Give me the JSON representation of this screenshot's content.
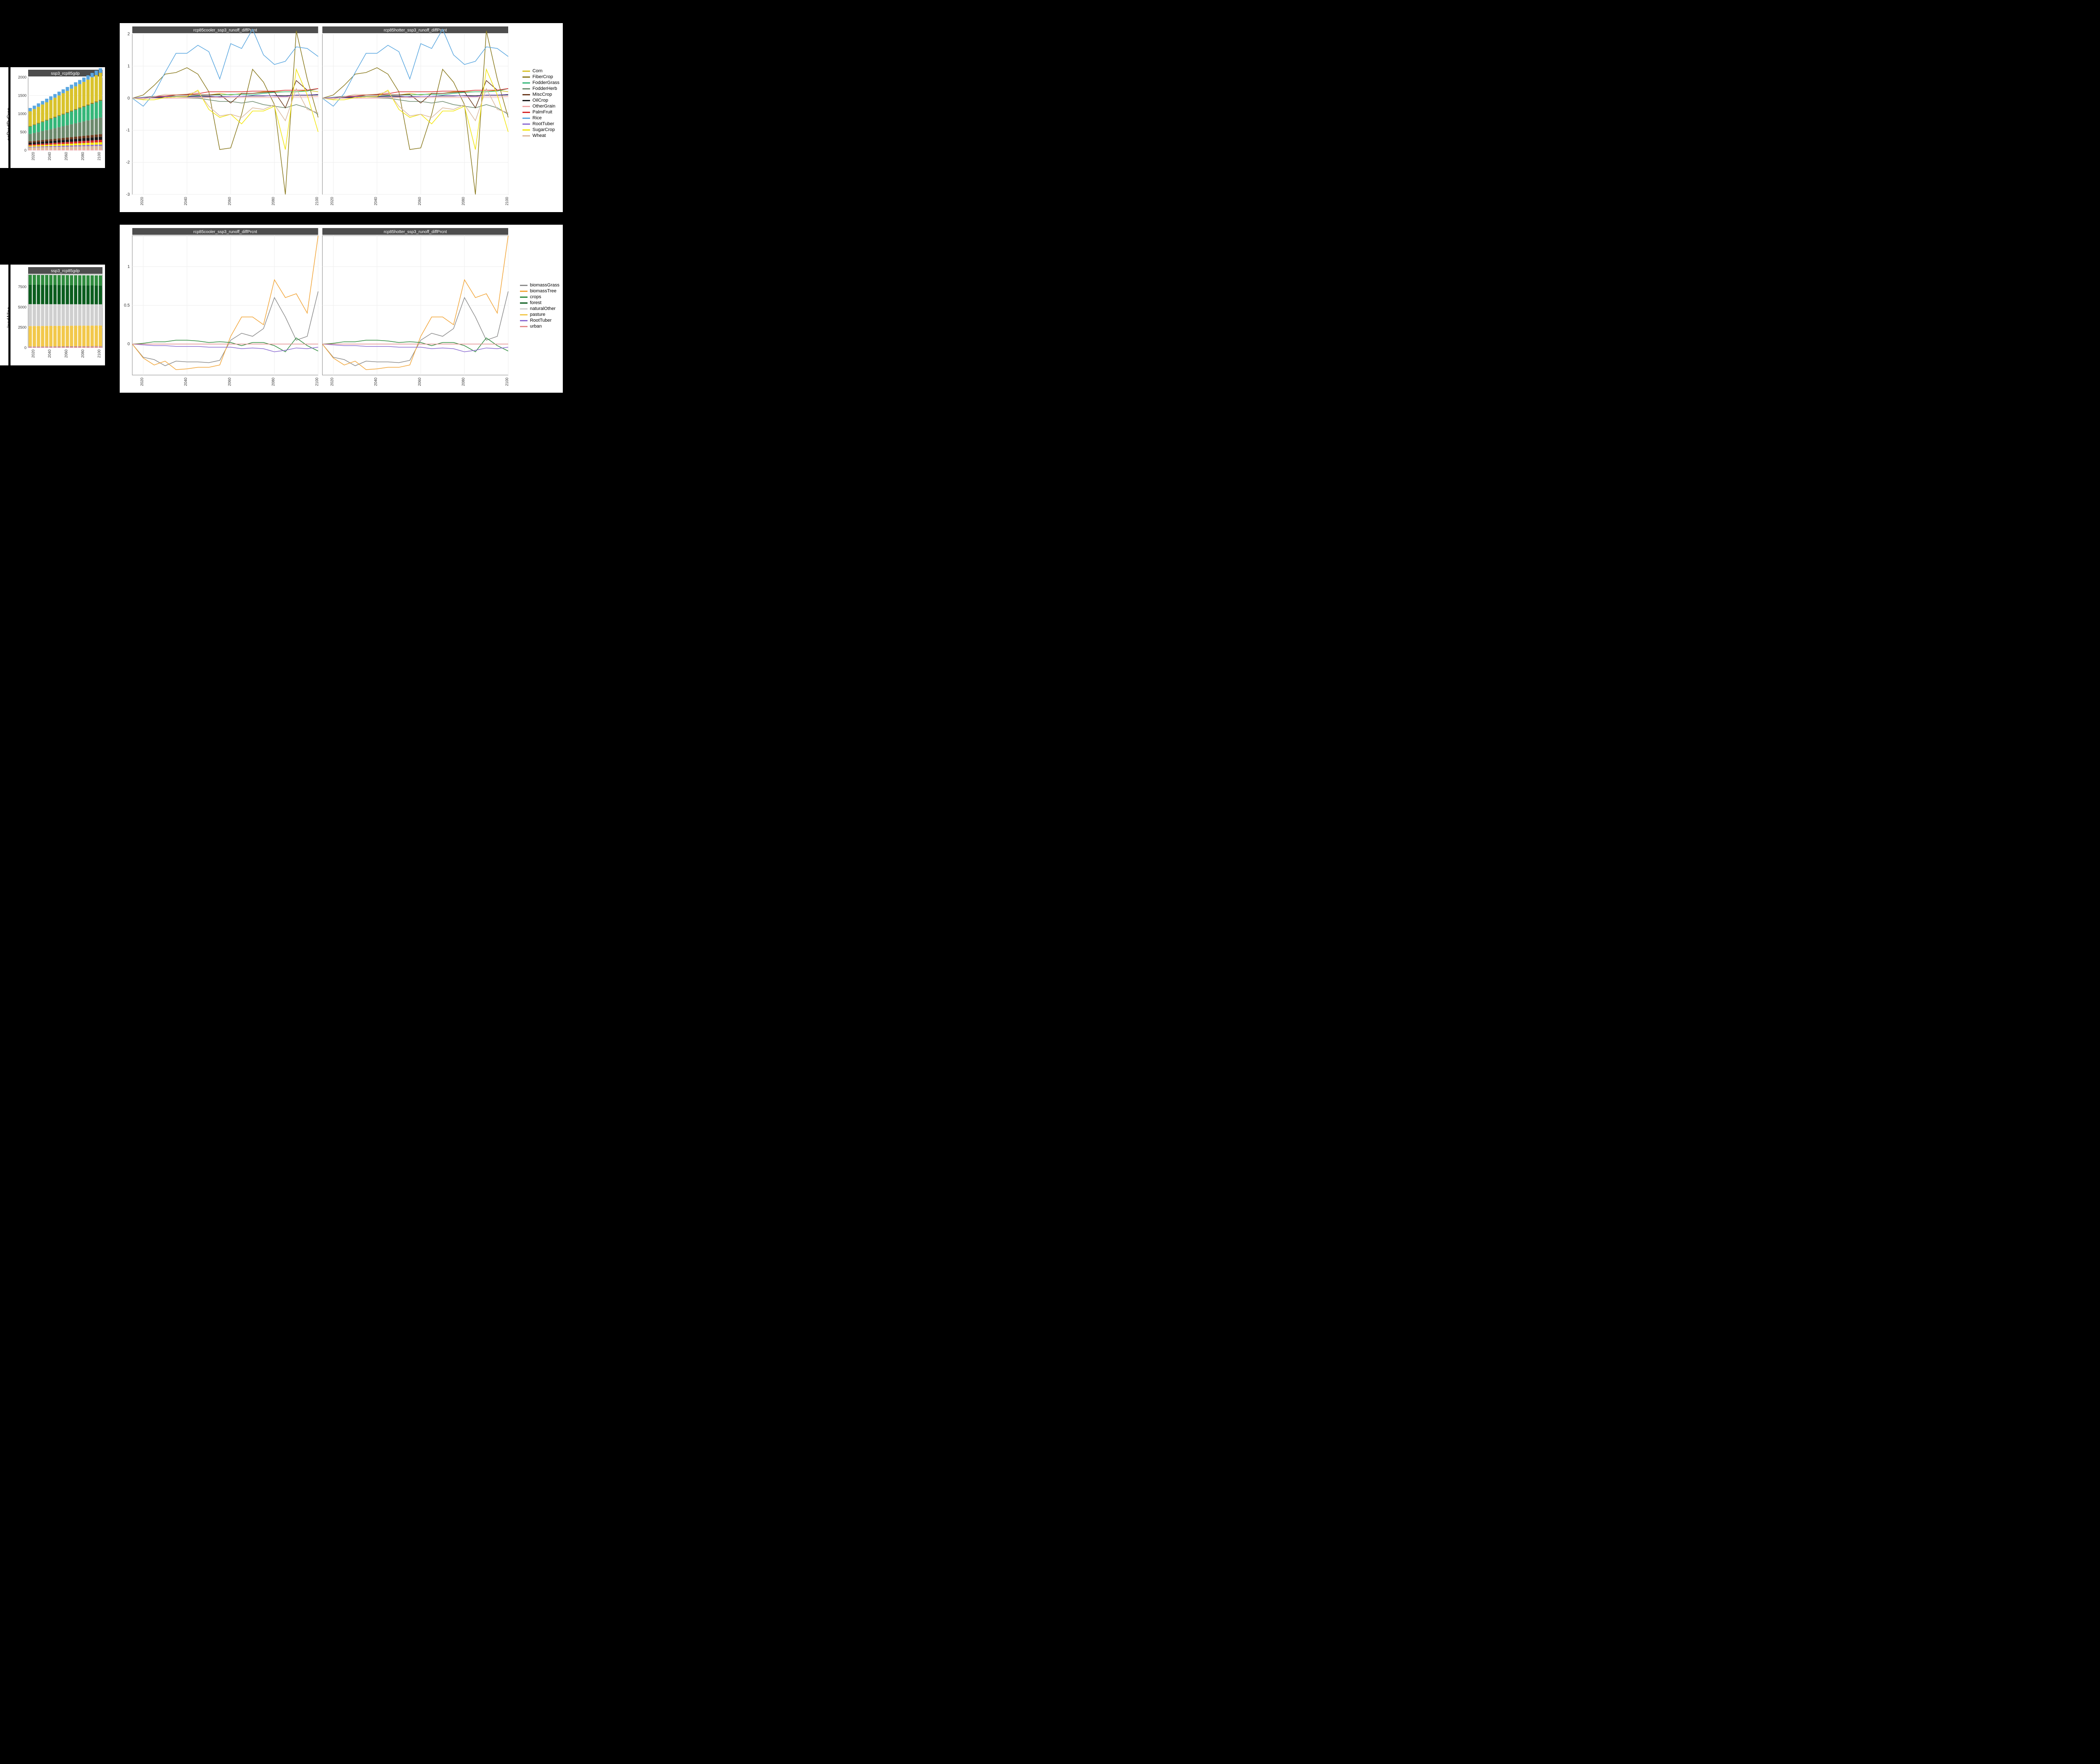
{
  "chart_data": [
    {
      "id": "agprod_bar",
      "type": "bar",
      "title": "ssp3_rcp85gdp",
      "ylabel": "agProdByCrop",
      "x": [
        2015,
        2020,
        2025,
        2030,
        2035,
        2040,
        2045,
        2050,
        2055,
        2060,
        2065,
        2070,
        2075,
        2080,
        2085,
        2090,
        2095,
        2100
      ],
      "ylim": [
        0,
        2000
      ],
      "yticks": [
        0,
        500,
        1000,
        1500,
        2000
      ],
      "stack_order": [
        "OtherGrain",
        "Wheat",
        "RootTuber",
        "SugarCrop",
        "PalmFruit",
        "OilCrop",
        "MiscCrop",
        "FodderHerb",
        "FodderGrass",
        "FiberCrop",
        "Corn",
        "Rice"
      ],
      "series": {
        "Rice": [
          90,
          92,
          94,
          96,
          98,
          100,
          102,
          104,
          106,
          108,
          110,
          112,
          114,
          116,
          118,
          120,
          122,
          124
        ],
        "Corn": [
          400,
          420,
          440,
          460,
          480,
          500,
          520,
          540,
          560,
          580,
          600,
          620,
          640,
          660,
          680,
          700,
          720,
          740
        ],
        "FiberCrop": [
          20,
          20,
          20,
          21,
          21,
          22,
          22,
          23,
          23,
          24,
          24,
          25,
          25,
          26,
          26,
          27,
          27,
          28
        ],
        "FodderGrass": [
          200,
          215,
          230,
          245,
          260,
          275,
          290,
          305,
          320,
          335,
          350,
          365,
          380,
          395,
          410,
          425,
          440,
          455
        ],
        "FodderHerb": [
          200,
          215,
          230,
          245,
          260,
          275,
          290,
          305,
          320,
          335,
          350,
          365,
          380,
          395,
          410,
          425,
          440,
          455
        ],
        "MiscCrop": [
          40,
          42,
          44,
          46,
          48,
          50,
          52,
          54,
          56,
          58,
          60,
          62,
          64,
          66,
          68,
          70,
          72,
          74
        ],
        "OilCrop": [
          50,
          52,
          54,
          56,
          58,
          60,
          62,
          64,
          66,
          68,
          70,
          72,
          74,
          76,
          78,
          80,
          82,
          84
        ],
        "PalmFruit": [
          30,
          32,
          34,
          36,
          38,
          40,
          42,
          44,
          46,
          48,
          50,
          52,
          54,
          56,
          58,
          60,
          62,
          64
        ],
        "SugarCrop": [
          30,
          32,
          34,
          36,
          38,
          40,
          42,
          44,
          46,
          48,
          50,
          52,
          54,
          56,
          58,
          60,
          62,
          64
        ],
        "RootTuber": [
          20,
          21,
          22,
          23,
          24,
          25,
          26,
          27,
          28,
          29,
          30,
          31,
          32,
          33,
          34,
          35,
          36,
          37
        ],
        "Wheat": [
          60,
          62,
          64,
          66,
          68,
          70,
          72,
          74,
          76,
          78,
          80,
          82,
          84,
          86,
          88,
          90,
          92,
          94
        ],
        "OtherGrain": [
          20,
          20,
          20,
          21,
          21,
          22,
          22,
          23,
          23,
          24,
          24,
          25,
          25,
          26,
          26,
          27,
          27,
          28
        ]
      }
    },
    {
      "id": "landalloc_bar",
      "type": "bar",
      "title": "ssp3_rcp85gdp",
      "ylabel": "landAlloc",
      "x": [
        2015,
        2020,
        2025,
        2030,
        2035,
        2040,
        2045,
        2050,
        2055,
        2060,
        2065,
        2070,
        2075,
        2080,
        2085,
        2090,
        2095,
        2100
      ],
      "ylim": [
        0,
        9000
      ],
      "yticks": [
        0,
        2500,
        5000,
        7500
      ],
      "stack_order": [
        "urban",
        "RootTuber",
        "biomassGrass",
        "biomassTree",
        "pasture",
        "naturalOther",
        "forest",
        "crops"
      ],
      "series": {
        "crops": [
          1200,
          1200,
          1200,
          1200,
          1210,
          1210,
          1210,
          1215,
          1215,
          1220,
          1220,
          1225,
          1225,
          1230,
          1230,
          1235,
          1235,
          1240
        ],
        "forest": [
          2400,
          2395,
          2390,
          2385,
          2380,
          2375,
          2370,
          2365,
          2360,
          2355,
          2350,
          2345,
          2340,
          2335,
          2330,
          2325,
          2320,
          2315
        ],
        "naturalOther": [
          2700,
          2695,
          2690,
          2685,
          2680,
          2675,
          2670,
          2665,
          2660,
          2655,
          2650,
          2645,
          2640,
          2635,
          2630,
          2625,
          2620,
          2615
        ],
        "pasture": [
          2500,
          2500,
          2500,
          2500,
          2500,
          2500,
          2500,
          2500,
          2500,
          2500,
          2500,
          2500,
          2500,
          2500,
          2500,
          2500,
          2500,
          2500
        ],
        "biomassTree": [
          30,
          32,
          34,
          36,
          38,
          40,
          42,
          44,
          46,
          48,
          50,
          52,
          54,
          56,
          58,
          60,
          62,
          64
        ],
        "biomassGrass": [
          30,
          30,
          30,
          30,
          30,
          30,
          30,
          30,
          30,
          30,
          30,
          30,
          30,
          30,
          30,
          30,
          30,
          30
        ],
        "RootTuber": [
          30,
          30,
          30,
          30,
          30,
          30,
          30,
          30,
          30,
          30,
          30,
          30,
          30,
          30,
          30,
          30,
          30,
          30
        ],
        "urban": [
          80,
          82,
          84,
          86,
          88,
          90,
          92,
          94,
          96,
          98,
          100,
          102,
          104,
          106,
          108,
          110,
          112,
          114
        ]
      }
    },
    {
      "id": "agprod_lines",
      "type": "line",
      "facets": [
        "rcp85cooler_ssp3_runoff_diffPrcnt",
        "rcp85hotter_ssp3_runoff_diffPrcnt"
      ],
      "x": [
        2015,
        2020,
        2025,
        2030,
        2035,
        2040,
        2045,
        2050,
        2055,
        2060,
        2065,
        2070,
        2075,
        2080,
        2085,
        2090,
        2095,
        2100
      ],
      "ylim": [
        -3,
        2
      ],
      "yticks": [
        -3,
        -2,
        -1,
        0,
        1,
        2
      ],
      "xticks": [
        2020,
        2040,
        2060,
        2080,
        2100
      ],
      "series": {
        "Corn": [
          0,
          0,
          0.05,
          0.05,
          0.1,
          0.1,
          0.1,
          0.1,
          0.15,
          0.1,
          0.15,
          0.15,
          0.2,
          0.2,
          0.2,
          0.2,
          0.25,
          0.2
        ],
        "FiberCrop": [
          0,
          0.1,
          0.4,
          0.75,
          0.8,
          0.95,
          0.75,
          0.2,
          -1.6,
          -1.55,
          -0.5,
          0.9,
          0.5,
          -0.2,
          -3.0,
          2.1,
          0.6,
          -0.6
        ],
        "FodderGrass": [
          0,
          0.03,
          0.06,
          0.07,
          0.06,
          0.06,
          0.08,
          0.1,
          0.1,
          0.12,
          0.12,
          0.1,
          0.15,
          0.18,
          0.2,
          0.2,
          0.22,
          0.3
        ],
        "FodderHerb": [
          0,
          0,
          0,
          0,
          0,
          0,
          0,
          -0.05,
          -0.1,
          -0.1,
          -0.15,
          -0.1,
          -0.2,
          -0.25,
          -0.3,
          -0.2,
          -0.3,
          -0.5
        ],
        "MiscCrop": [
          0,
          0,
          0.05,
          0.05,
          0.1,
          0.1,
          0.1,
          0.1,
          0.12,
          -0.15,
          0.15,
          0.15,
          0.18,
          0.2,
          -0.3,
          0.55,
          0.25,
          0.3
        ],
        "OilCrop": [
          0,
          0,
          0.02,
          0.02,
          0.04,
          0.04,
          0.05,
          0.05,
          0.05,
          0.06,
          0.06,
          0.07,
          0.07,
          0.08,
          0.08,
          0.09,
          0.09,
          0.1
        ],
        "OtherGrain": [
          0,
          0,
          0,
          0,
          0,
          0,
          0.02,
          0.02,
          0.02,
          0.02,
          0.03,
          0.03,
          0.03,
          0.03,
          0.04,
          0.04,
          0.04,
          0.05
        ],
        "PalmFruit": [
          0,
          0.02,
          0.05,
          0.07,
          0.1,
          0.12,
          0.14,
          0.2,
          0.2,
          0.2,
          0.2,
          0.22,
          0.22,
          0.22,
          0.25,
          0.25,
          0.25,
          0.3
        ],
        "Rice": [
          0,
          -0.25,
          0.15,
          0.8,
          1.4,
          1.4,
          1.65,
          1.45,
          0.6,
          1.7,
          1.55,
          2.15,
          1.35,
          1.05,
          1.15,
          1.6,
          1.55,
          1.3
        ],
        "RootTuber": [
          0,
          0.02,
          0.03,
          0.05,
          0.05,
          0.06,
          0.06,
          0.07,
          0.04,
          0.06,
          0.06,
          0.08,
          0.08,
          0.07,
          0.05,
          0.1,
          0.1,
          0.12
        ],
        "SugarCrop": [
          0,
          -0.05,
          -0.05,
          0.02,
          0.04,
          0.05,
          0.25,
          -0.35,
          -0.6,
          -0.5,
          -0.8,
          -0.4,
          -0.4,
          -0.25,
          -1.6,
          0.9,
          0.1,
          -1.05
        ],
        "Wheat": [
          0,
          -0.03,
          0.05,
          0.12,
          0.11,
          0.13,
          0.2,
          -0.25,
          -0.55,
          -0.5,
          -0.6,
          -0.3,
          -0.35,
          -0.2,
          -0.7,
          0.3,
          -0.35,
          -0.45
        ]
      }
    },
    {
      "id": "landalloc_lines",
      "type": "line",
      "facets": [
        "rcp85cooler_ssp3_runoff_diffPrcnt",
        "rcp85hotter_ssp3_runoff_diffPrcnt"
      ],
      "x": [
        2015,
        2020,
        2025,
        2030,
        2035,
        2040,
        2045,
        2050,
        2055,
        2060,
        2065,
        2070,
        2075,
        2080,
        2085,
        2090,
        2095,
        2100
      ],
      "ylim": [
        -0.4,
        1.4
      ],
      "yticks": [
        0,
        0.5,
        1.0
      ],
      "xticks": [
        2020,
        2040,
        2060,
        2080,
        2100
      ],
      "series": {
        "biomassGrass": [
          0,
          -0.17,
          -0.2,
          -0.28,
          -0.22,
          -0.23,
          -0.23,
          -0.24,
          -0.21,
          0.05,
          0.14,
          0.1,
          0.2,
          0.6,
          0.35,
          0.05,
          0.1,
          0.68
        ],
        "biomassTree": [
          0,
          -0.18,
          -0.27,
          -0.22,
          -0.33,
          -0.32,
          -0.3,
          -0.3,
          -0.27,
          0.1,
          0.35,
          0.35,
          0.25,
          0.83,
          0.6,
          0.65,
          0.4,
          1.4
        ],
        "crops": [
          0,
          0.01,
          0.03,
          0.03,
          0.05,
          0.05,
          0.04,
          0.02,
          0.03,
          0.02,
          -0.02,
          0.02,
          0.02,
          -0.02,
          -0.1,
          0.08,
          -0.02,
          -0.09
        ],
        "forest": [
          0,
          0,
          0,
          0,
          0,
          0,
          0,
          0,
          0,
          0,
          0,
          0,
          0,
          0,
          0,
          0,
          0,
          0
        ],
        "naturalOther": [
          0,
          0,
          0,
          0,
          0,
          0,
          0,
          0,
          0,
          0,
          0,
          0,
          0,
          0,
          0,
          0,
          0,
          0
        ],
        "pasture": [
          0,
          0,
          0,
          0,
          0,
          0,
          0,
          0,
          0,
          0,
          0,
          0,
          0,
          0,
          0,
          0,
          0,
          0
        ],
        "RootTuber": [
          0,
          -0.01,
          -0.02,
          -0.02,
          -0.03,
          -0.03,
          -0.03,
          -0.04,
          -0.04,
          -0.04,
          -0.06,
          -0.05,
          -0.06,
          -0.1,
          -0.08,
          -0.05,
          -0.06,
          -0.04
        ],
        "urban": [
          0,
          0,
          0,
          0,
          0,
          0,
          0,
          0,
          0,
          0,
          0,
          0,
          0,
          0,
          0,
          0,
          0,
          0
        ]
      }
    }
  ],
  "colors": {
    "Corn": "#d9c32c",
    "FiberCrop": "#8a7a1f",
    "FodderGrass": "#35b779",
    "FodderHerb": "#6d8a6d",
    "MiscCrop": "#6b3a1e",
    "OilCrop": "#1a1a1a",
    "OtherGrain": "#f2a6a6",
    "PalmFruit": "#d62728",
    "Rice": "#5aa7e0",
    "RootTuber": "#8b6bd1",
    "SugarCrop": "#f2e60c",
    "Wheat": "#d9b89c",
    "biomassGrass": "#8c8c8c",
    "biomassTree": "#f2a63a",
    "crops": "#2e8b3d",
    "forest": "#0b5d1e",
    "naturalOther": "#cfcfcf",
    "pasture": "#f2c84b",
    "urban": "#e38b8b"
  },
  "legend_crops": [
    "Corn",
    "FiberCrop",
    "FodderGrass",
    "FodderHerb",
    "MiscCrop",
    "OilCrop",
    "OtherGrain",
    "PalmFruit",
    "Rice",
    "RootTuber",
    "SugarCrop",
    "Wheat"
  ],
  "legend_land": [
    "biomassGrass",
    "biomassTree",
    "crops",
    "forest",
    "naturalOther",
    "pasture",
    "RootTuber",
    "urban"
  ],
  "labels": {
    "ylab_top": "agProdByCrop",
    "ylab_bot": "landAlloc"
  }
}
